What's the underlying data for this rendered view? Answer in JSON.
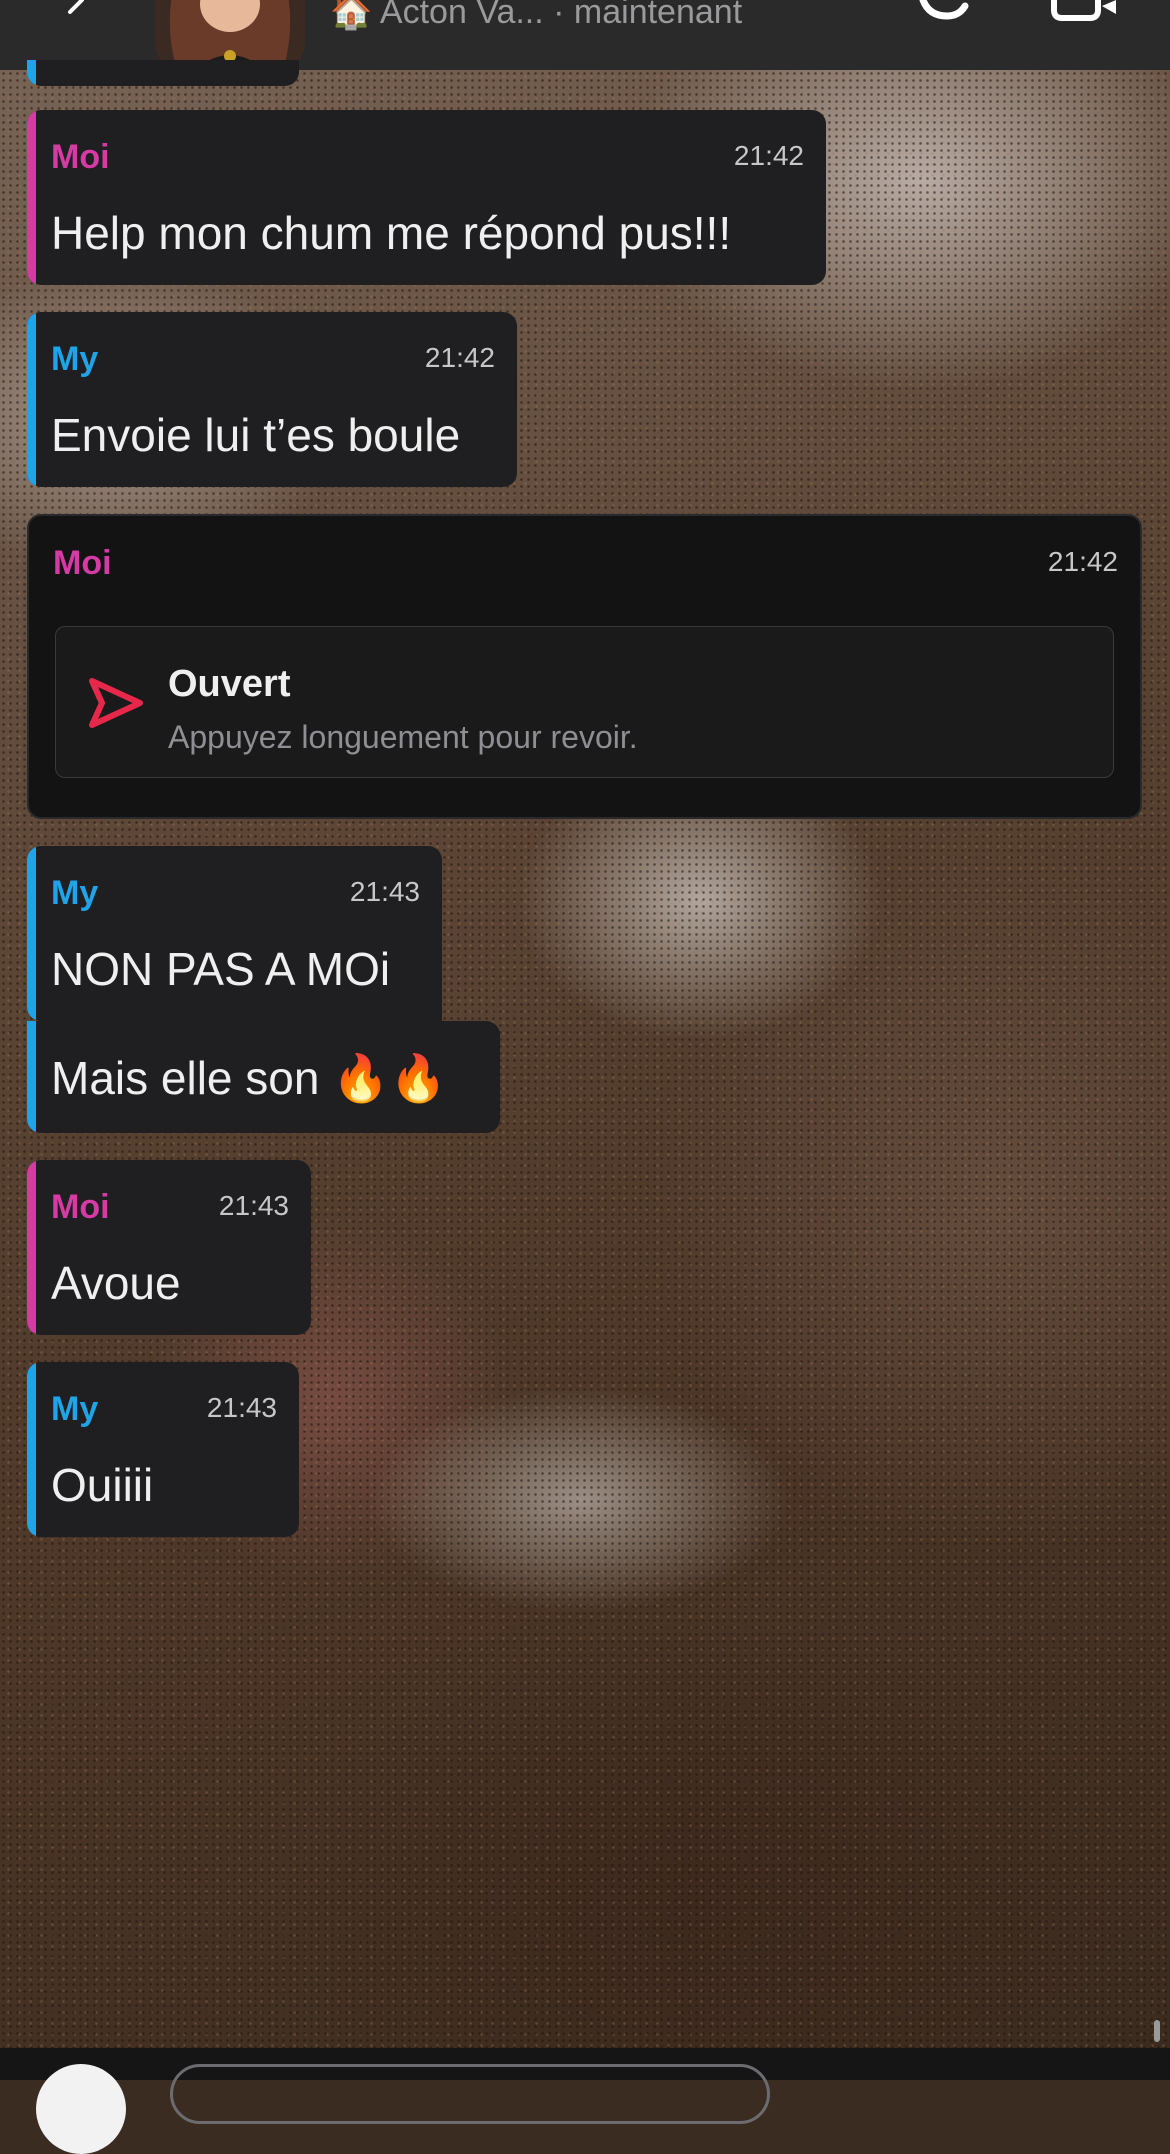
{
  "header": {
    "title": "🏠 Acton Va... · maintenant"
  },
  "messages": [
    {
      "sender": "Moi",
      "time": "21:42",
      "text": "Help mon chum me répond pus!!!"
    },
    {
      "sender": "My",
      "time": "21:42",
      "text": "Envoie lui t’es boule"
    },
    {
      "sender": "Moi",
      "time": "21:42",
      "snap_title": "Ouvert",
      "snap_subtitle": "Appuyez longuement pour revoir."
    },
    {
      "sender": "My",
      "time": "21:43",
      "text": "NON PAS A MOi"
    },
    {
      "text": "Mais elle son 🔥🔥"
    },
    {
      "sender": "Moi",
      "time": "21:43",
      "text": "Avoue"
    },
    {
      "sender": "My",
      "time": "21:43",
      "text": "Ouiiii"
    }
  ],
  "colors": {
    "me": "#d63aa5",
    "them": "#1fa4ea",
    "bubble": "#1f1f21",
    "snap_icon": "#e8284a"
  },
  "icons": [
    "back-icon",
    "call-icon",
    "video-icon",
    "snap-arrow-icon",
    "camera-icon"
  ]
}
